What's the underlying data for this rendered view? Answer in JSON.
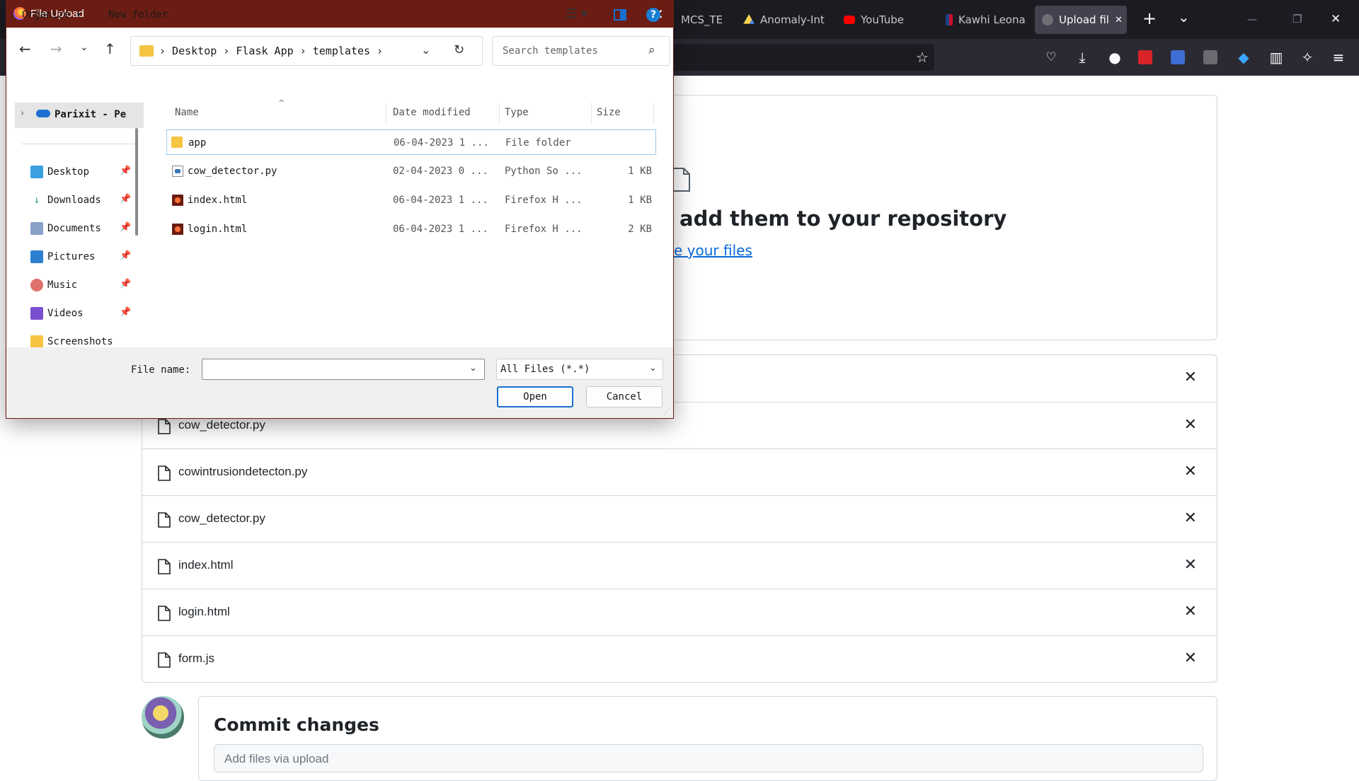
{
  "browser": {
    "tabs": [
      {
        "label": "MCS_TERM",
        "active": false
      },
      {
        "label": "Anomaly-Int",
        "active": false
      },
      {
        "label": "YouTube",
        "active": false
      },
      {
        "label": "Kawhi Leona",
        "active": false
      },
      {
        "label": "Upload fil",
        "active": true
      }
    ],
    "new_tab": "+",
    "list_tabs": "⌄",
    "close_tab": "✕",
    "minimize": "—",
    "restore": "❐",
    "close_window": "✕"
  },
  "page": {
    "drop_title": "add them to your repository",
    "drop_link": "e your files",
    "uploaded_files": [
      "cow_detector.py",
      "cowintrusiondetecton.py",
      "cow_detector.py",
      "index.html",
      "login.html",
      "form.js"
    ],
    "remove_label": "✕",
    "commit_title": "Commit changes",
    "commit_placeholder": "Add files via upload"
  },
  "dialog": {
    "title": "File Upload",
    "close": "✕",
    "breadcrumb": "›  Desktop  ›  Flask App  ›  templates  ›",
    "search_placeholder": "Search templates",
    "organize": "Organize ▾",
    "new_folder": "New folder",
    "help": "?",
    "nav_top": "Parixit - Pe",
    "nav_items": [
      {
        "label": "Desktop",
        "icon": "desktop-icon",
        "color": "#3aa0e0"
      },
      {
        "label": "Downloads",
        "icon": "download-icon",
        "color": "#21a366"
      },
      {
        "label": "Documents",
        "icon": "documents-icon",
        "color": "#8aa0c8"
      },
      {
        "label": "Pictures",
        "icon": "pictures-icon",
        "color": "#2f7fd0"
      },
      {
        "label": "Music",
        "icon": "music-icon",
        "color": "#e0706a"
      },
      {
        "label": "Videos",
        "icon": "videos-icon",
        "color": "#7a4fd0"
      },
      {
        "label": "Screenshots",
        "icon": "folder-icon",
        "color": "#f5c443"
      }
    ],
    "columns": {
      "name": "Name",
      "date": "Date modified",
      "type": "Type",
      "size": "Size"
    },
    "files": [
      {
        "name": "app",
        "date": "06-04-2023 1 ...",
        "type": "File folder",
        "size": "",
        "icon": "folder-icon"
      },
      {
        "name": "cow_detector.py",
        "date": "02-04-2023 0 ...",
        "type": "Python So ...",
        "size": "1 KB",
        "icon": "python-file-icon"
      },
      {
        "name": "index.html",
        "date": "06-04-2023 1 ...",
        "type": "Firefox H ...",
        "size": "1 KB",
        "icon": "firefox-html-icon"
      },
      {
        "name": "login.html",
        "date": "06-04-2023 1 ...",
        "type": "Firefox H ...",
        "size": "2 KB",
        "icon": "firefox-html-icon"
      }
    ],
    "file_name_label": "File name:",
    "file_name_value": "",
    "file_type": "All Files (*.*)",
    "open": "Open",
    "cancel": "Cancel"
  }
}
